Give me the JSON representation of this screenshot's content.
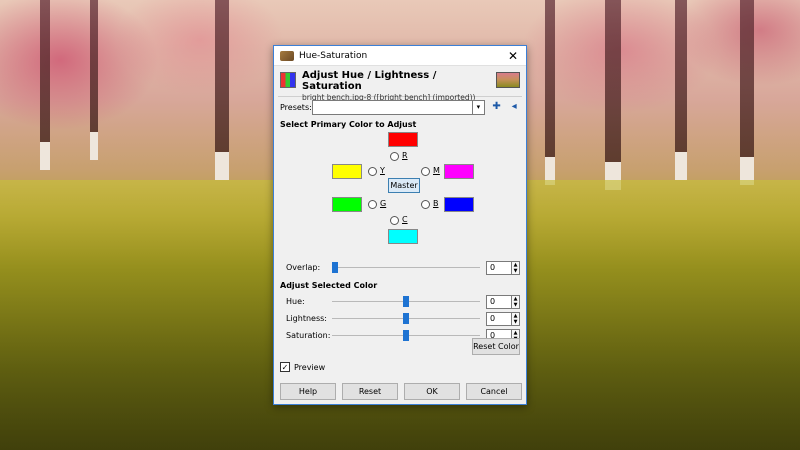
{
  "window": {
    "title": "Hue-Saturation",
    "close_glyph": "✕"
  },
  "header": {
    "title": "Adjust Hue / Lightness / Saturation",
    "subtitle": "bright bench.jpg-8 ([bright bench] (imported))",
    "thumbnail": "image-thumbnail"
  },
  "presets": {
    "label": "Presets:",
    "value": "",
    "add_icon": "plus-icon",
    "menu_icon": "menu-icon"
  },
  "primary": {
    "section_title": "Select Primary Color to Adjust",
    "master_label": "Master",
    "colors": [
      {
        "key": "R",
        "label": "R",
        "color": "#ff0000"
      },
      {
        "key": "Y",
        "label": "Y",
        "color": "#ffff00"
      },
      {
        "key": "M",
        "label": "M",
        "color": "#ff00ff"
      },
      {
        "key": "G",
        "label": "G",
        "color": "#00ff00"
      },
      {
        "key": "B",
        "label": "B",
        "color": "#0000ff"
      },
      {
        "key": "C",
        "label": "C",
        "color": "#00ffff"
      }
    ],
    "overlap": {
      "label": "Overlap:",
      "value": "0",
      "fraction": 0
    }
  },
  "adjust": {
    "section_title": "Adjust Selected Color",
    "hue": {
      "label": "Hue:",
      "value": "0",
      "fraction": 0.5
    },
    "lightness": {
      "label": "Lightness:",
      "value": "0",
      "fraction": 0.5
    },
    "saturation": {
      "label": "Saturation:",
      "value": "0",
      "fraction": 0.5
    },
    "reset_label": "Reset Color"
  },
  "preview": {
    "label": "Preview",
    "checked": true
  },
  "buttons": {
    "help": "Help",
    "reset": "Reset",
    "ok": "OK",
    "cancel": "Cancel"
  }
}
